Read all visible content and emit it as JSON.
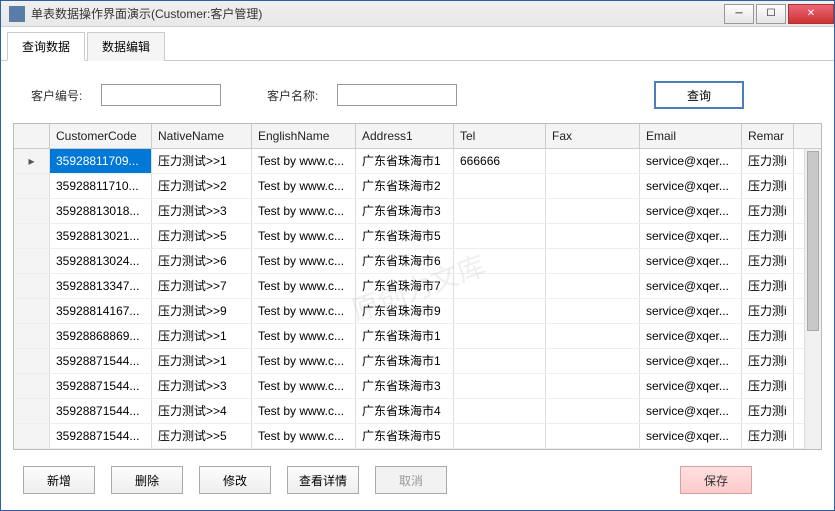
{
  "window": {
    "title": "单表数据操作界面演示(Customer:客户管理)"
  },
  "tabs": [
    {
      "label": "查询数据",
      "active": true
    },
    {
      "label": "数据编辑",
      "active": false
    }
  ],
  "search": {
    "label_code": "客户编号:",
    "value_code": "",
    "label_name": "客户名称:",
    "value_name": "",
    "query_btn": "查询"
  },
  "grid": {
    "columns": [
      "CustomerCode",
      "NativeName",
      "EnglishName",
      "Address1",
      "Tel",
      "Fax",
      "Email",
      "Remar"
    ],
    "rows": [
      {
        "sel": true,
        "ind": "▸",
        "cells": [
          "35928811709...",
          "压力测试>>1",
          "Test by www.c...",
          "广东省珠海市1",
          "666666",
          "",
          "service@xqer...",
          "压力测i"
        ]
      },
      {
        "cells": [
          "35928811710...",
          "压力测试>>2",
          "Test by www.c...",
          "广东省珠海市2",
          "",
          "",
          "service@xqer...",
          "压力测i"
        ]
      },
      {
        "cells": [
          "35928813018...",
          "压力测试>>3",
          "Test by www.c...",
          "广东省珠海市3",
          "",
          "",
          "service@xqer...",
          "压力测i"
        ]
      },
      {
        "cells": [
          "35928813021...",
          "压力测试>>5",
          "Test by www.c...",
          "广东省珠海市5",
          "",
          "",
          "service@xqer...",
          "压力测i"
        ]
      },
      {
        "cells": [
          "35928813024...",
          "压力测试>>6",
          "Test by www.c...",
          "广东省珠海市6",
          "",
          "",
          "service@xqer...",
          "压力测i"
        ]
      },
      {
        "cells": [
          "35928813347...",
          "压力测试>>7",
          "Test by www.c...",
          "广东省珠海市7",
          "",
          "",
          "service@xqer...",
          "压力测i"
        ]
      },
      {
        "cells": [
          "35928814167...",
          "压力测试>>9",
          "Test by www.c...",
          "广东省珠海市9",
          "",
          "",
          "service@xqer...",
          "压力测i"
        ]
      },
      {
        "cells": [
          "35928868869...",
          "压力测试>>1",
          "Test by www.c...",
          "广东省珠海市1",
          "",
          "",
          "service@xqer...",
          "压力测i"
        ]
      },
      {
        "cells": [
          "35928871544...",
          "压力测试>>1",
          "Test by www.c...",
          "广东省珠海市1",
          "",
          "",
          "service@xqer...",
          "压力测i"
        ]
      },
      {
        "cells": [
          "35928871544...",
          "压力测试>>3",
          "Test by www.c...",
          "广东省珠海市3",
          "",
          "",
          "service@xqer...",
          "压力测i"
        ]
      },
      {
        "cells": [
          "35928871544...",
          "压力测试>>4",
          "Test by www.c...",
          "广东省珠海市4",
          "",
          "",
          "service@xqer...",
          "压力测i"
        ]
      },
      {
        "cells": [
          "35928871544...",
          "压力测试>>5",
          "Test by www.c...",
          "广东省珠海市5",
          "",
          "",
          "service@xqer...",
          "压力测i"
        ]
      }
    ]
  },
  "footer": {
    "add": "新增",
    "delete": "删除",
    "edit": "修改",
    "detail": "查看详情",
    "cancel": "取消",
    "save": "保存"
  },
  "watermark": "原创力文库"
}
